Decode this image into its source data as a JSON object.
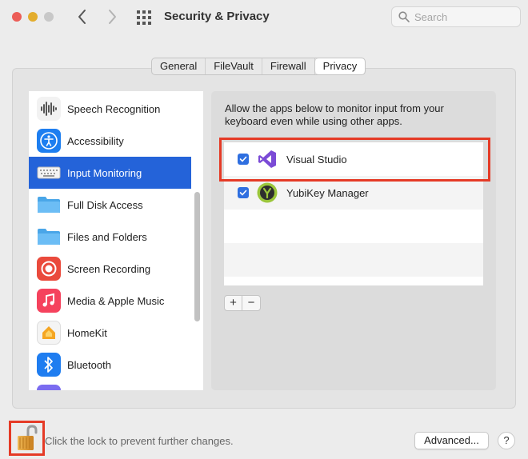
{
  "window": {
    "title": "Security & Privacy",
    "search_placeholder": "Search"
  },
  "tabs": [
    {
      "label": "General"
    },
    {
      "label": "FileVault"
    },
    {
      "label": "Firewall"
    },
    {
      "label": "Privacy",
      "active": true
    }
  ],
  "sidebar": {
    "items": [
      {
        "label": "Speech Recognition",
        "icon": "waveform-icon"
      },
      {
        "label": "Accessibility",
        "icon": "accessibility-icon"
      },
      {
        "label": "Input Monitoring",
        "icon": "keyboard-icon",
        "selected": true
      },
      {
        "label": "Full Disk Access",
        "icon": "folder-icon"
      },
      {
        "label": "Files and Folders",
        "icon": "folder-icon"
      },
      {
        "label": "Screen Recording",
        "icon": "record-icon"
      },
      {
        "label": "Media & Apple Music",
        "icon": "music-icon"
      },
      {
        "label": "HomeKit",
        "icon": "home-icon"
      },
      {
        "label": "Bluetooth",
        "icon": "bluetooth-icon"
      }
    ]
  },
  "main": {
    "description_line1": "Allow the apps below to monitor input from your",
    "description_line2": "keyboard even while using other apps.",
    "apps": [
      {
        "name": "Visual Studio",
        "checked": true,
        "icon": "visual-studio-icon"
      },
      {
        "name": "YubiKey Manager",
        "checked": true,
        "icon": "yubikey-icon"
      }
    ],
    "add_label": "+",
    "remove_label": "−"
  },
  "footer": {
    "lock_text": "Click the lock to prevent further changes.",
    "advanced_label": "Advanced...",
    "help_label": "?"
  },
  "colors": {
    "accent": "#2463d9",
    "highlight": "#e53a26",
    "checkbox": "#2f6fe0"
  }
}
